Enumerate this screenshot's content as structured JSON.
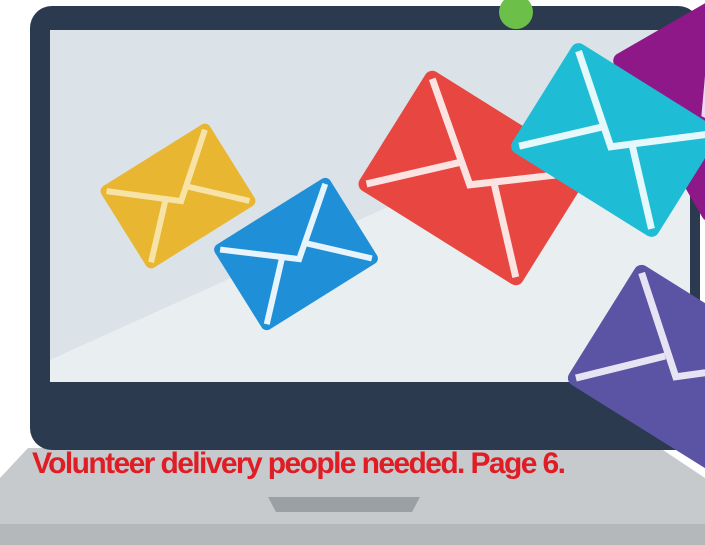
{
  "caption": {
    "text": "Volunteer delivery people needed.  Page 6.",
    "color": "#e01c24"
  },
  "colors": {
    "laptop_frame": "#2b3a4f",
    "screen": "#e9eef1",
    "screen_shadow": "#dbe3e8",
    "laptop_base": "#c6cacd",
    "webcam": "#6cc04a"
  },
  "envelopes": [
    {
      "name": "yellow-envelope",
      "color": "#e8b630"
    },
    {
      "name": "blue-envelope",
      "color": "#1f8fd8"
    },
    {
      "name": "red-envelope",
      "color": "#e84640"
    },
    {
      "name": "cyan-envelope",
      "color": "#1fbcd6"
    },
    {
      "name": "magenta-envelope",
      "color": "#8e1887"
    },
    {
      "name": "purple-envelope",
      "color": "#5b54a5"
    }
  ]
}
